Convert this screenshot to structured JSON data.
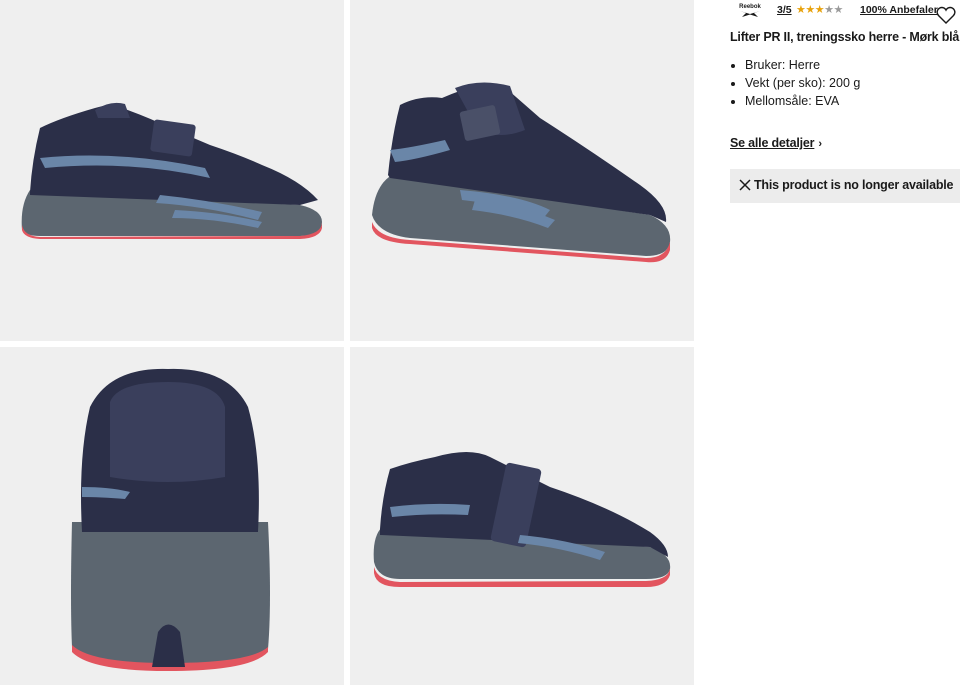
{
  "product": {
    "brand": "Reebok",
    "rating_score": "3/5",
    "rating_value": 3,
    "rating_max": 5,
    "recommend_text": "100% Anbefaler",
    "title": "Lifter PR II, treningssko herre - Mørk blå",
    "specs": [
      "Bruker: Herre",
      "Vekt (per sko): 200 g",
      "Mellomsåle: EVA"
    ],
    "details_link": "Se alle detaljer",
    "status_message": "This product is no longer available"
  },
  "gallery": {
    "images": [
      "shoe-side-view",
      "shoe-three-quarter-view",
      "shoe-back-view",
      "shoe-angled-side-view"
    ],
    "logo_text": "Reebok"
  },
  "colors": {
    "upper": "#2b2f48",
    "stripe": "#6a86a8",
    "midsole": "#5c6670",
    "outsole": "#e2555f",
    "star": "#e8a20c",
    "tile_bg": "#efefef"
  }
}
